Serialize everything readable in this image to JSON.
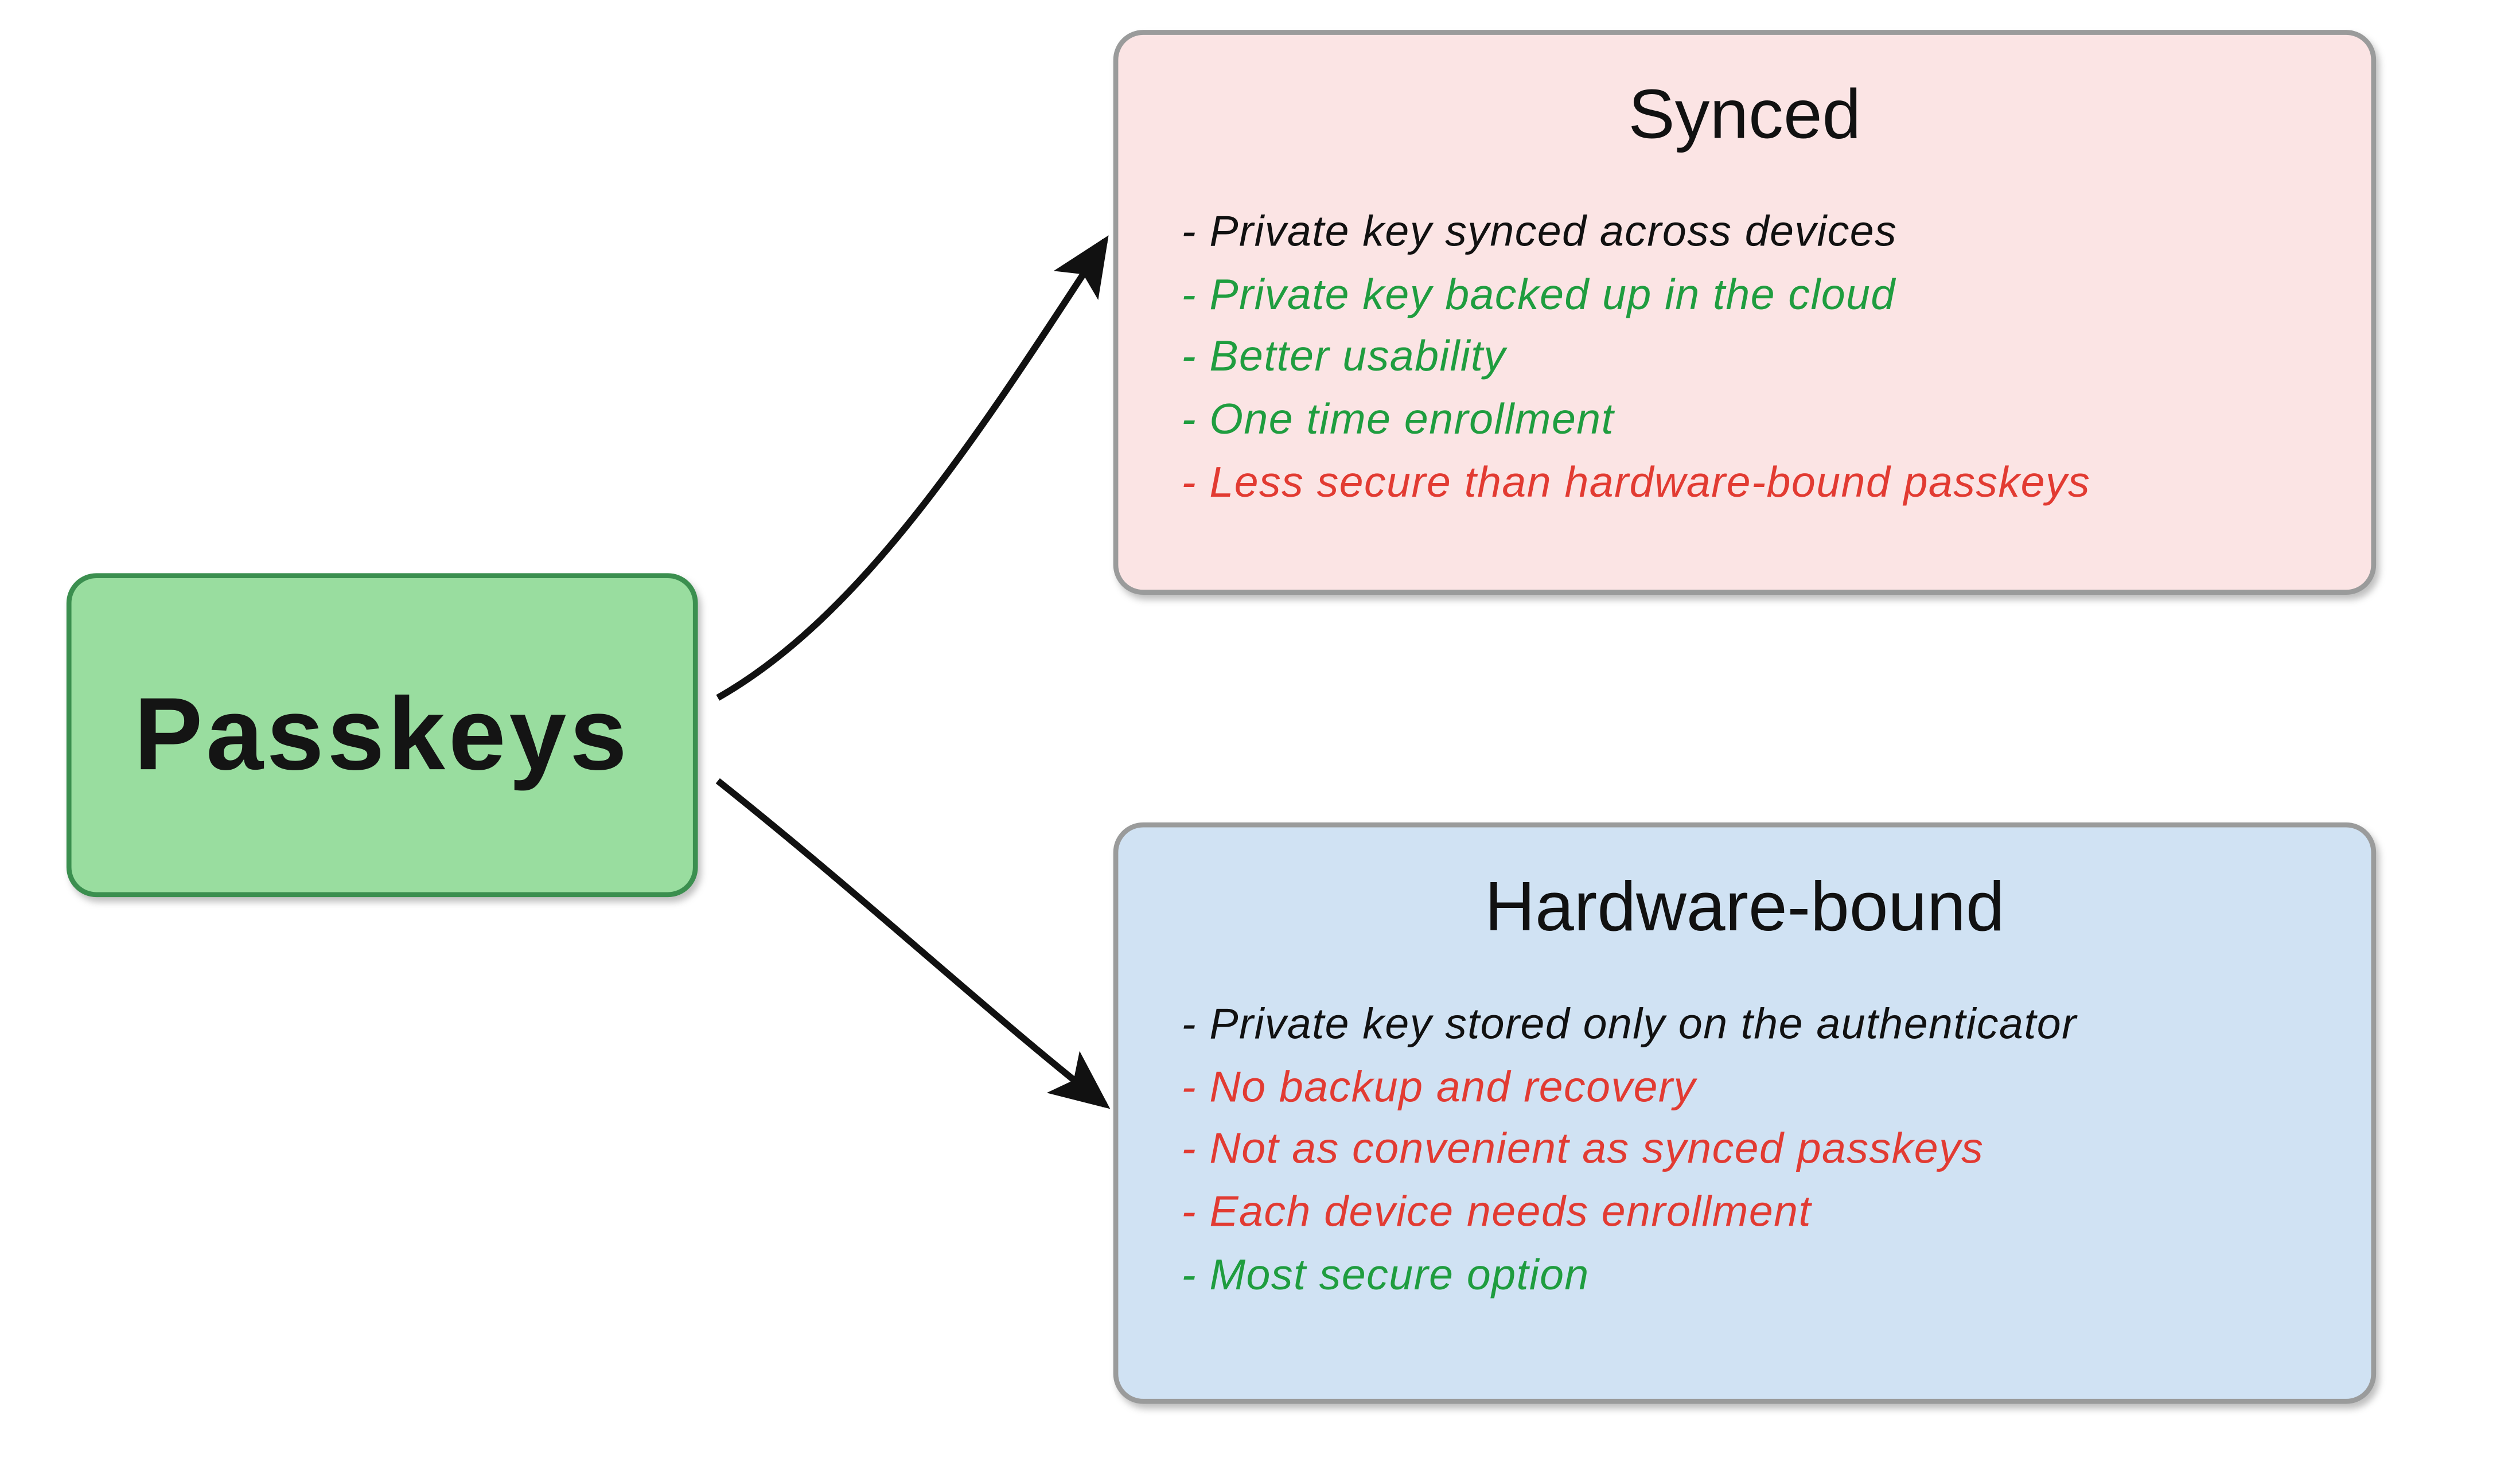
{
  "source": {
    "label": "Passkeys"
  },
  "colors": {
    "neutral": "#111111",
    "positive": "#1F9D3F",
    "negative": "#E23B32",
    "source_fill": "#99DD9F",
    "source_border": "#3B8F4F",
    "synced_fill": "#FBE4E4",
    "hardware_fill": "#D0E2F3",
    "detail_border": "#9A9B9B"
  },
  "boxes": [
    {
      "id": "synced",
      "title": "Synced",
      "items": [
        {
          "text": "- Private key synced across devices",
          "tone": "neutral"
        },
        {
          "text": "- Private key backed up in the cloud",
          "tone": "positive"
        },
        {
          "text": "- Better usability",
          "tone": "positive"
        },
        {
          "text": "- One time enrollment",
          "tone": "positive"
        },
        {
          "text": "- Less secure than hardware-bound passkeys",
          "tone": "negative"
        }
      ]
    },
    {
      "id": "hardware",
      "title": "Hardware-bound",
      "items": [
        {
          "text": "- Private key stored only on the authenticator",
          "tone": "neutral"
        },
        {
          "text": "- No backup and recovery",
          "tone": "negative"
        },
        {
          "text": "- Not as convenient as synced passkeys",
          "tone": "negative"
        },
        {
          "text": "- Each device needs enrollment",
          "tone": "negative"
        },
        {
          "text": "- Most secure option",
          "tone": "positive"
        }
      ]
    }
  ]
}
